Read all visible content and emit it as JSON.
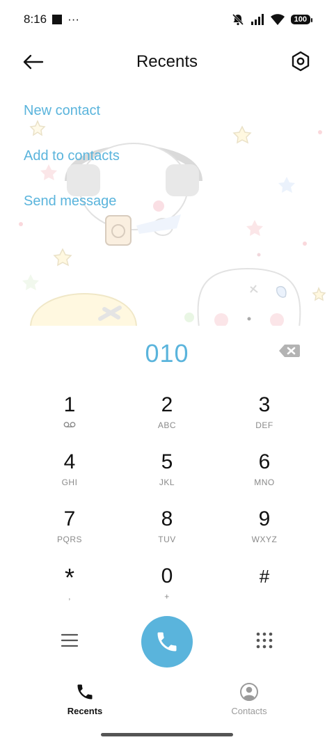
{
  "status_bar": {
    "time": "8:16",
    "more": "···",
    "battery": "100"
  },
  "header": {
    "title": "Recents"
  },
  "actions": {
    "new_contact": "New contact",
    "add_to_contacts": "Add to contacts",
    "send_message": "Send message"
  },
  "dialer": {
    "number": "010"
  },
  "keypad": [
    {
      "digit": "1",
      "letters": ""
    },
    {
      "digit": "2",
      "letters": "ABC"
    },
    {
      "digit": "3",
      "letters": "DEF"
    },
    {
      "digit": "4",
      "letters": "GHI"
    },
    {
      "digit": "5",
      "letters": "JKL"
    },
    {
      "digit": "6",
      "letters": "MNO"
    },
    {
      "digit": "7",
      "letters": "PQRS"
    },
    {
      "digit": "8",
      "letters": "TUV"
    },
    {
      "digit": "9",
      "letters": "WXYZ"
    },
    {
      "digit": "*",
      "letters": ","
    },
    {
      "digit": "0",
      "letters": "+"
    },
    {
      "digit": "#",
      "letters": ""
    }
  ],
  "tabs": {
    "recents": "Recents",
    "contacts": "Contacts"
  },
  "colors": {
    "accent": "#5ab4dc",
    "text": "#111111",
    "muted": "#8a8a8a"
  }
}
